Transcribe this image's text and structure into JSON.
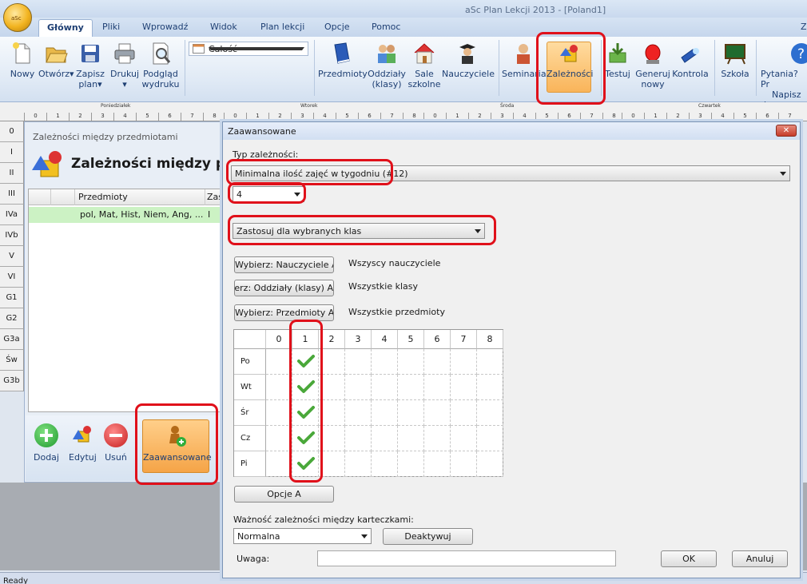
{
  "app": {
    "title": "aSc Plan Lekcji 2013  - [Poland1]",
    "orb_label": "aSc"
  },
  "tabs": [
    "Główny",
    "Pliki",
    "Wprowadź",
    "Widok",
    "Plan lekcji",
    "Opcje",
    "Pomoc"
  ],
  "ribbon": {
    "nowy": "Nowy",
    "otworz": "Otwórz",
    "zapisz": "Zapisz",
    "zapisz2": "plan",
    "drukuj": "Drukuj",
    "podglad": "Podgląd",
    "podglad2": "wydruku",
    "calosc": "Całość",
    "przedmioty": "Przedmioty",
    "oddzialy": "Oddziały",
    "oddzialy2": "(klasy)",
    "sale": "Sale",
    "sale2": "szkolne",
    "nauczyciele": "Nauczyciele",
    "seminaria": "Seminaria",
    "zaleznosci": "Zależności",
    "testuj": "Testuj",
    "generuj": "Generuj",
    "generuj2": "nowy",
    "kontrola": "Kontrola",
    "szkola": "Szkoła",
    "pytania": "Pytania? Pr",
    "pytania2": "Napisz d",
    "z": "Z"
  },
  "grid_header": {
    "days": [
      "Poniedziałek",
      "Wtorek",
      "Środa",
      "Czwartek"
    ],
    "periods": [
      "0",
      "1",
      "2",
      "3",
      "4",
      "5",
      "6",
      "7",
      "8"
    ]
  },
  "row_labels": [
    "0",
    "I",
    "II",
    "III",
    "IVa",
    "IVb",
    "V",
    "VI",
    "G1",
    "G2",
    "G3a",
    "Św",
    "G3b"
  ],
  "inner_window": {
    "caption": "Zależności między przedmiotami",
    "heading": "Zależności między przed",
    "col_subjects": "Przedmioty",
    "col_z": "Zas",
    "row_subjects": "pol, Mat, Hist, Niem, Ang, ...",
    "row_z": "I",
    "btn_dodaj": "Dodaj",
    "btn_edytuj": "Edytuj",
    "btn_usun": "Usuń",
    "btn_zaawansowane": "Zaawansowane"
  },
  "dialog": {
    "title": "Zaawansowane",
    "close": "✕",
    "typ_label": "Typ zależności:",
    "typ_value": "Minimalna ilość zajęć w tygodniu (#12)",
    "count_value": "4",
    "apply_value": "Zastosuj dla wybranych klas",
    "btn_nauczyciele": "Wybierz: Nauczyciele A",
    "txt_nauczyciele": "Wszyscy nauczyciele",
    "btn_oddzialy": "Wybierz: Oddziały (klasy) A",
    "txt_oddzialy": "Wszystkie klasy",
    "btn_przedmioty": "Wybierz: Przedmioty A",
    "txt_przedmioty": "Wszystkie przedmioty",
    "grid_cols": [
      "0",
      "1",
      "2",
      "3",
      "4",
      "5",
      "6",
      "7",
      "8"
    ],
    "grid_rows": [
      "Po",
      "Wt",
      "Śr",
      "Cz",
      "Pi"
    ],
    "checked_column": "1",
    "btn_opcje": "Opcje A",
    "waznosc_label": "Ważność zależności między karteczkami:",
    "waznosc_value": "Normalna",
    "btn_deaktywuj": "Deaktywuj",
    "uwaga_label": "Uwaga:",
    "uwaga_value": "",
    "btn_ok": "OK",
    "btn_anuluj": "Anuluj"
  },
  "status": "Ready"
}
